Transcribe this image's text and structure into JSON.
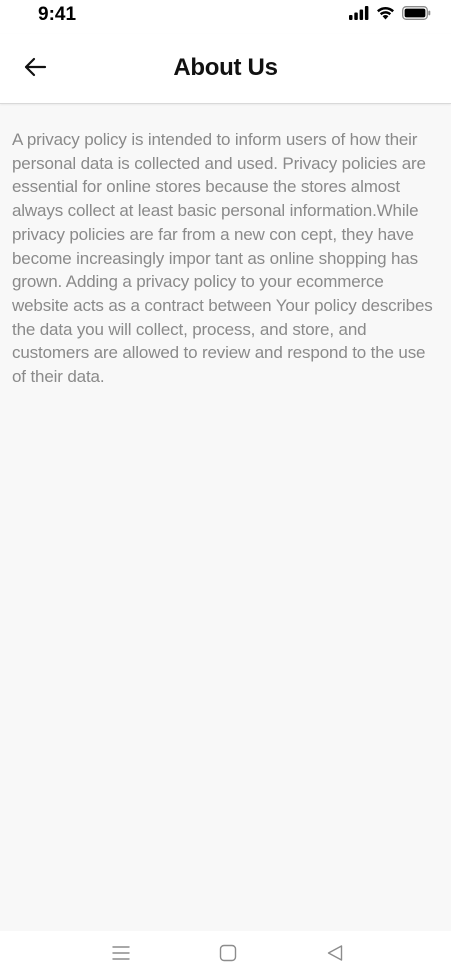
{
  "status_bar": {
    "time": "9:41",
    "icons": [
      "signal-icon",
      "wifi-icon",
      "battery-icon"
    ]
  },
  "header": {
    "title": "About Us",
    "back_icon": "arrow-left-icon"
  },
  "content": {
    "body": "A privacy policy is intended to inform users of how their personal data is collected and used. Privacy policies are essential for online stores because the stores almost always collect at least basic personal information.While privacy policies are far from a new con cept, they have become increasingly impor tant as online shopping has grown. Adding a privacy policy to your ecommerce website acts as a contract between Your policy describes the data you will collect, process, and store, and customers are allowed to review and respond to the use of their data."
  },
  "system_nav": {
    "icons": [
      "menu-icon",
      "home-icon",
      "back-triangle-icon"
    ]
  },
  "colors": {
    "background": "#f8f8f8",
    "header_background": "#ffffff",
    "body_text": "#8a8a8a",
    "title_text": "#111111"
  }
}
